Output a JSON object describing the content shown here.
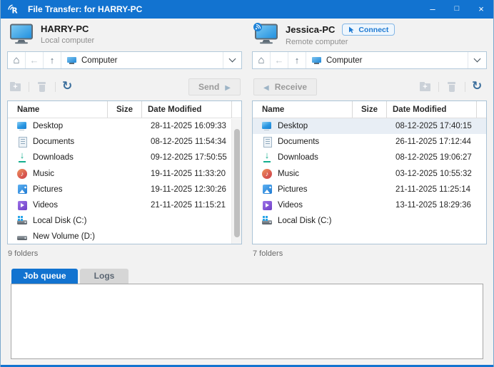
{
  "titlebar": {
    "title": "File Transfer: for HARRY-PC",
    "controls": {
      "minimize": "–",
      "maximize": "□",
      "close": "×"
    }
  },
  "local": {
    "name": "HARRY-PC",
    "type_label": "Local computer",
    "address": "Computer",
    "send_label": "Send",
    "status": "9 folders",
    "columns": [
      "Name",
      "Size",
      "Date Modified"
    ],
    "rows": [
      {
        "icon": "desktop",
        "name": "Desktop",
        "size": "",
        "date": "28-11-2025 16:09:33"
      },
      {
        "icon": "documents",
        "name": "Documents",
        "size": "",
        "date": "08-12-2025 11:54:34"
      },
      {
        "icon": "downloads",
        "name": "Downloads",
        "size": "",
        "date": "09-12-2025 17:50:55"
      },
      {
        "icon": "music",
        "name": "Music",
        "size": "",
        "date": "19-11-2025 11:33:20"
      },
      {
        "icon": "pictures",
        "name": "Pictures",
        "size": "",
        "date": "19-11-2025 12:30:26"
      },
      {
        "icon": "videos",
        "name": "Videos",
        "size": "",
        "date": "21-11-2025 11:15:21"
      },
      {
        "icon": "disk-os",
        "name": "Local Disk (C:)",
        "size": "",
        "date": ""
      },
      {
        "icon": "disk",
        "name": "New Volume (D:)",
        "size": "",
        "date": ""
      }
    ]
  },
  "remote": {
    "name": "Jessica-PC",
    "type_label": "Remote computer",
    "connect_label": "Connect",
    "address": "Computer",
    "receive_label": "Receive",
    "status": "7 folders",
    "columns": [
      "Name",
      "Size",
      "Date Modified"
    ],
    "rows": [
      {
        "icon": "desktop",
        "name": "Desktop",
        "size": "",
        "date": "08-12-2025 17:40:15",
        "selected": true
      },
      {
        "icon": "documents",
        "name": "Documents",
        "size": "",
        "date": "26-11-2025 17:12:44"
      },
      {
        "icon": "downloads",
        "name": "Downloads",
        "size": "",
        "date": "08-12-2025 19:06:27"
      },
      {
        "icon": "music",
        "name": "Music",
        "size": "",
        "date": "03-12-2025 10:55:32"
      },
      {
        "icon": "pictures",
        "name": "Pictures",
        "size": "",
        "date": "21-11-2025 11:25:14"
      },
      {
        "icon": "videos",
        "name": "Videos",
        "size": "",
        "date": "13-11-2025 18:29:36"
      },
      {
        "icon": "disk-os",
        "name": "Local Disk (C:)",
        "size": "",
        "date": ""
      }
    ]
  },
  "tabs": {
    "job_queue": "Job queue",
    "logs": "Logs"
  },
  "colors": {
    "accent": "#1273d0",
    "selection": "#e8eef5",
    "titlebar": "#1273d0"
  }
}
